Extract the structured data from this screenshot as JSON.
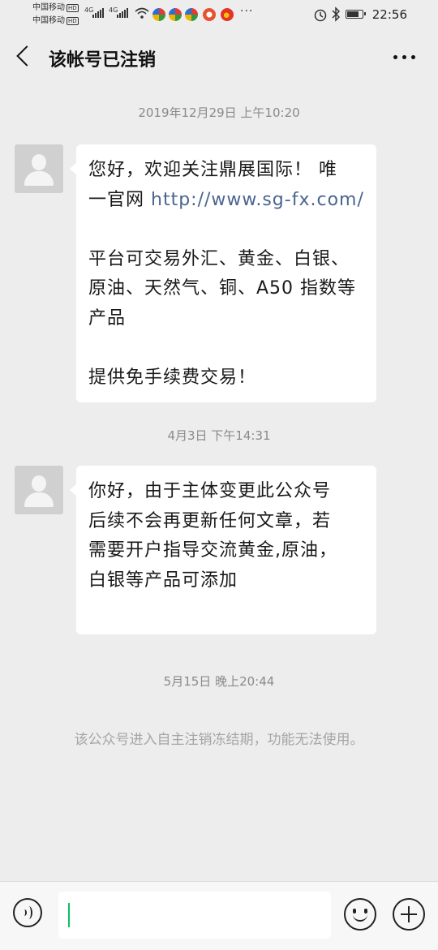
{
  "status_bar": {
    "carrier_1": "中国移动",
    "carrier_2": "中国移动",
    "hd_badge": "HD",
    "network_1": "4G",
    "network_2": "4G",
    "time": "22:56",
    "more_dots": "···",
    "icons": [
      "signal-icon",
      "wifi-icon",
      "app-icon",
      "weibo-icon",
      "alarm-icon",
      "bluetooth-icon",
      "battery-icon"
    ]
  },
  "header": {
    "title": "该帐号已注销",
    "back_icon": "chevron-left-icon",
    "more_icon": "more-dots-icon"
  },
  "messages": [
    {
      "timestamp": "2019年12月29日 上午10:20",
      "lines": [
        "您好，欢迎关注鼎展国际！ 唯",
        "一官网 ",
        "平台可交易外汇、黄金、白银、",
        "原油、天然气、铜、A50 指数等",
        "产品",
        "提供免手续费交易！"
      ],
      "link": "http://www.sg-fx.com/"
    },
    {
      "timestamp": "4月3日 下午14:31",
      "lines": [
        "你好，由于主体变更此公众号",
        "后续不会再更新任何文章，若",
        "需要开户指导交流黄金,原油，",
        "白银等产品可添加"
      ]
    }
  ],
  "system": {
    "timestamp": "5月15日 晚上20:44",
    "notice": "该公众号进入自主注销冻结期，功能无法使用。"
  },
  "input_bar": {
    "text_value": "",
    "icons": [
      "voice-icon",
      "emoji-icon",
      "plus-icon"
    ]
  },
  "colors": {
    "background": "#ededed",
    "bubble": "#ffffff",
    "link": "#4a6590",
    "caret": "#07c160"
  }
}
